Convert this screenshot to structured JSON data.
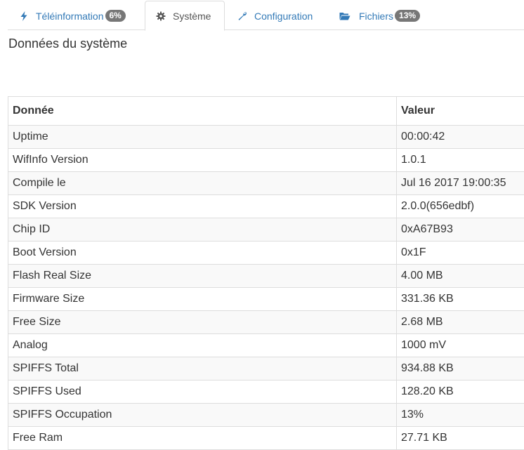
{
  "tabs": [
    {
      "label": "Téléinformation",
      "icon": "bolt-icon",
      "badge": "6%"
    },
    {
      "label": "Système",
      "icon": "gear-icon"
    },
    {
      "label": "Configuration",
      "icon": "wrench-icon"
    },
    {
      "label": "Fichiers",
      "icon": "folder-open-icon",
      "badge": "13%"
    }
  ],
  "page_title": "Données du système",
  "table": {
    "headers": [
      "Donnée",
      "Valeur"
    ],
    "rows": [
      [
        "Uptime",
        "00:00:42"
      ],
      [
        "WifInfo Version",
        "1.0.1"
      ],
      [
        "Compile le",
        "Jul 16 2017 19:00:35"
      ],
      [
        "SDK Version",
        "2.0.0(656edbf)"
      ],
      [
        "Chip ID",
        "0xA67B93"
      ],
      [
        "Boot Version",
        "0x1F"
      ],
      [
        "Flash Real Size",
        "4.00 MB"
      ],
      [
        "Firmware Size",
        "331.36 KB"
      ],
      [
        "Free Size",
        "2.68 MB"
      ],
      [
        "Analog",
        "1000 mV"
      ],
      [
        "SPIFFS Total",
        "934.88 KB"
      ],
      [
        "SPIFFS Used",
        "128.20 KB"
      ],
      [
        "SPIFFS Occupation",
        "13%"
      ],
      [
        "Free Ram",
        "27.71 KB"
      ]
    ]
  },
  "colors": {
    "link": "#337ab7",
    "badge": "#777777",
    "border": "#dddddd",
    "stripe": "#f9f9f9"
  }
}
